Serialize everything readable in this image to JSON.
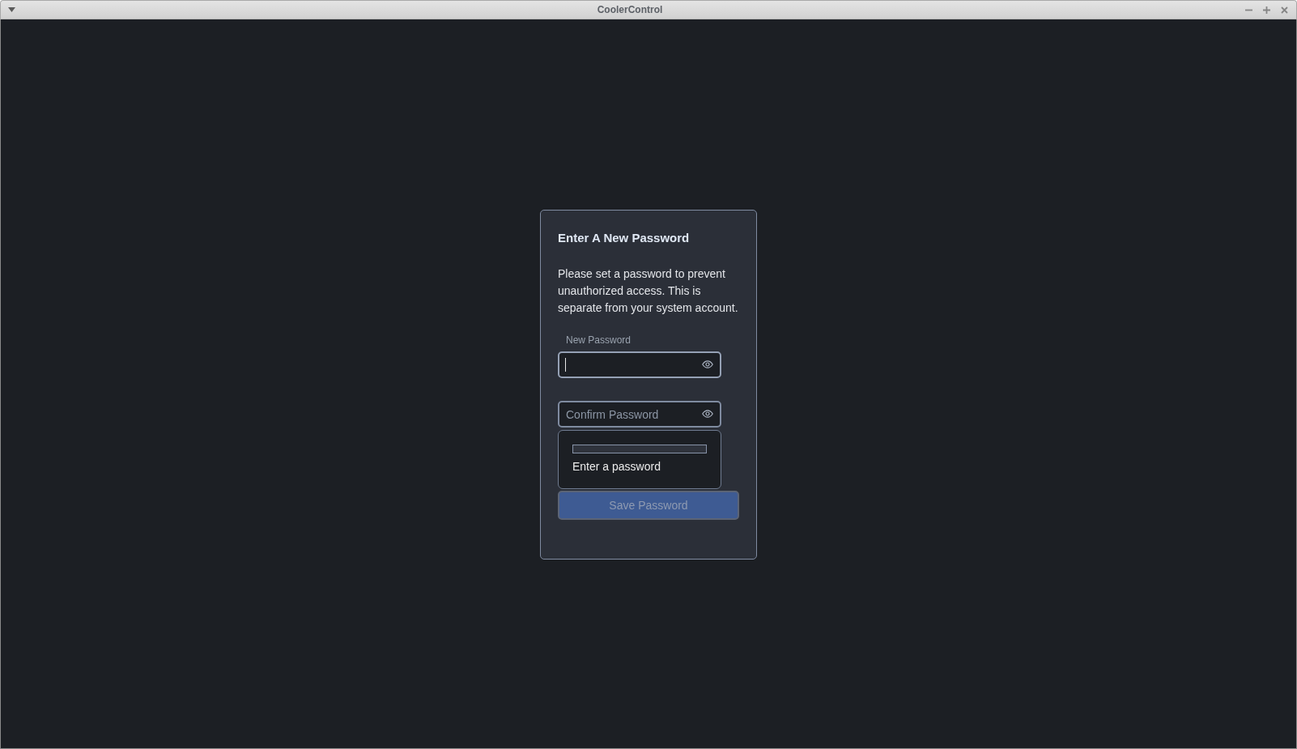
{
  "window": {
    "title": "CoolerControl"
  },
  "dialog": {
    "title": "Enter A New Password",
    "message": "Please set a password to prevent unauthorized access. This is separate from your system account.",
    "fields": [
      {
        "label": "New Password",
        "focused": true
      },
      {
        "placeholder": "Confirm Password",
        "focused": false
      }
    ],
    "strength_popup": {
      "level": 0,
      "message": "Enter a password"
    },
    "save_button": {
      "label": "Save Password",
      "disabled": true
    }
  }
}
